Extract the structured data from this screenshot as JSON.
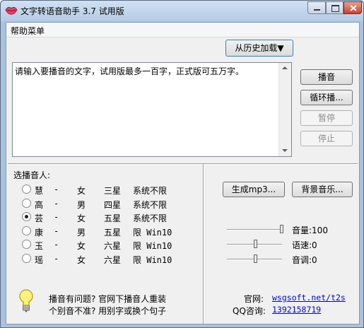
{
  "window": {
    "title": "文字转语音助手 3.7 试用版"
  },
  "menu": {
    "help": "帮助菜单"
  },
  "history_button": "从历史加载▼",
  "textbox": {
    "value": "请输入要播音的文字，试用版最多一百字，正式版可五万字。"
  },
  "buttons": {
    "play": "播音",
    "loop": "循环播...",
    "pause": "暂停",
    "stop": "停止",
    "gen_mp3": "生成mp3...",
    "bg_music": "背景音乐..."
  },
  "voice_heading": "选播音人:",
  "voices": [
    {
      "name": "慧",
      "gender": "女",
      "stars": "三星",
      "limit": "系统不限",
      "selected": false
    },
    {
      "name": "高",
      "gender": "男",
      "stars": "四星",
      "limit": "系统不限",
      "selected": false
    },
    {
      "name": "芸",
      "gender": "女",
      "stars": "五星",
      "limit": "系统不限",
      "selected": true
    },
    {
      "name": "康",
      "gender": "男",
      "stars": "五星",
      "limit": "限 Win10",
      "selected": false
    },
    {
      "name": "玉",
      "gender": "女",
      "stars": "六星",
      "limit": "限 Win10",
      "selected": false
    },
    {
      "name": "瑶",
      "gender": "女",
      "stars": "六星",
      "limit": "限 Win10",
      "selected": false
    }
  ],
  "sliders": {
    "volume": {
      "label": "音量:100",
      "position": 1.0
    },
    "speed": {
      "label": "语速:0",
      "position": 0.5
    },
    "pitch": {
      "label": "音调:0",
      "position": 0.5
    }
  },
  "hint": {
    "line1": "播音有问题? 官网下播音人重装",
    "line2": "个别音不准? 用别字或换个句子"
  },
  "website": {
    "label": "官网:",
    "url": "wsgsoft.net/t2s"
  },
  "qq": {
    "label": "QQ咨询:",
    "number": "1392158719"
  },
  "colors": {
    "link": "#0000ee",
    "title_bar": "#b6cde6",
    "close_button": "#c8422c"
  }
}
